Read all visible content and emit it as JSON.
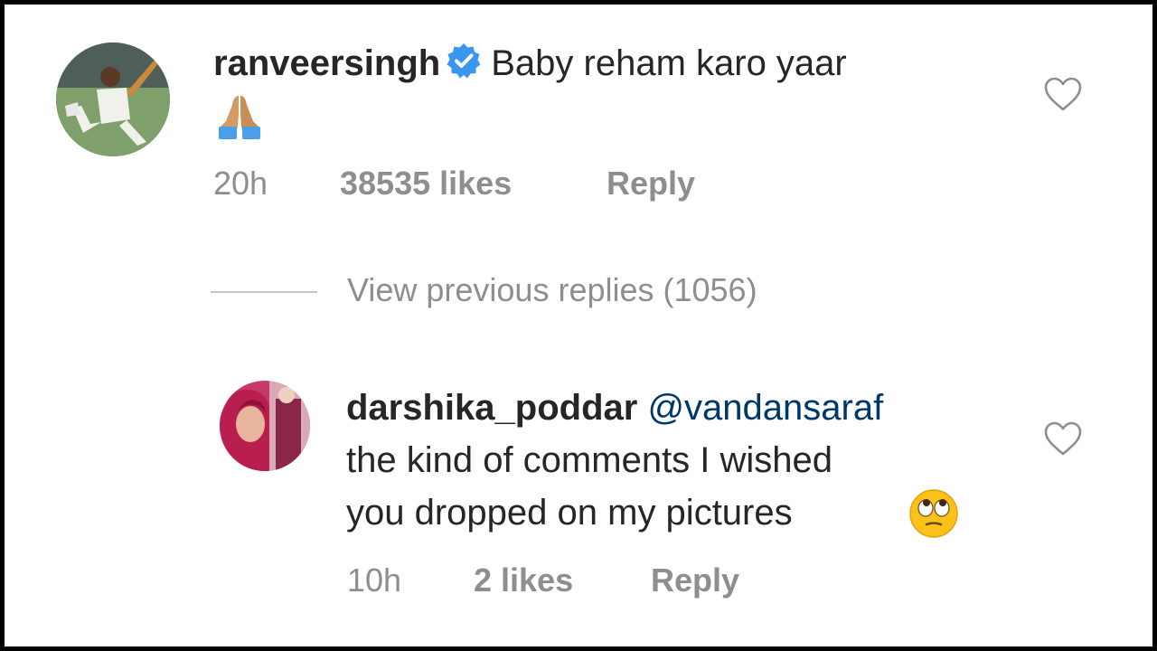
{
  "comments": [
    {
      "username": "ranveersingh",
      "verified": true,
      "text": "Baby reham karo yaar",
      "emoji": "folded-hands",
      "time": "20h",
      "likes": "38535 likes",
      "reply_label": "Reply"
    },
    {
      "username": "darshika_poddar",
      "mention": "@vandansaraf",
      "text_line1": "the kind of comments I wished",
      "text_line2": "you dropped on my pictures",
      "emoji": "face-with-rolling-eyes",
      "time": "10h",
      "likes": "2 likes",
      "reply_label": "Reply"
    }
  ],
  "view_previous_replies": "View previous replies (1056)",
  "colors": {
    "text": "#262626",
    "muted": "#8e8e8e",
    "mention": "#00376b",
    "verified": "#3897f0"
  }
}
